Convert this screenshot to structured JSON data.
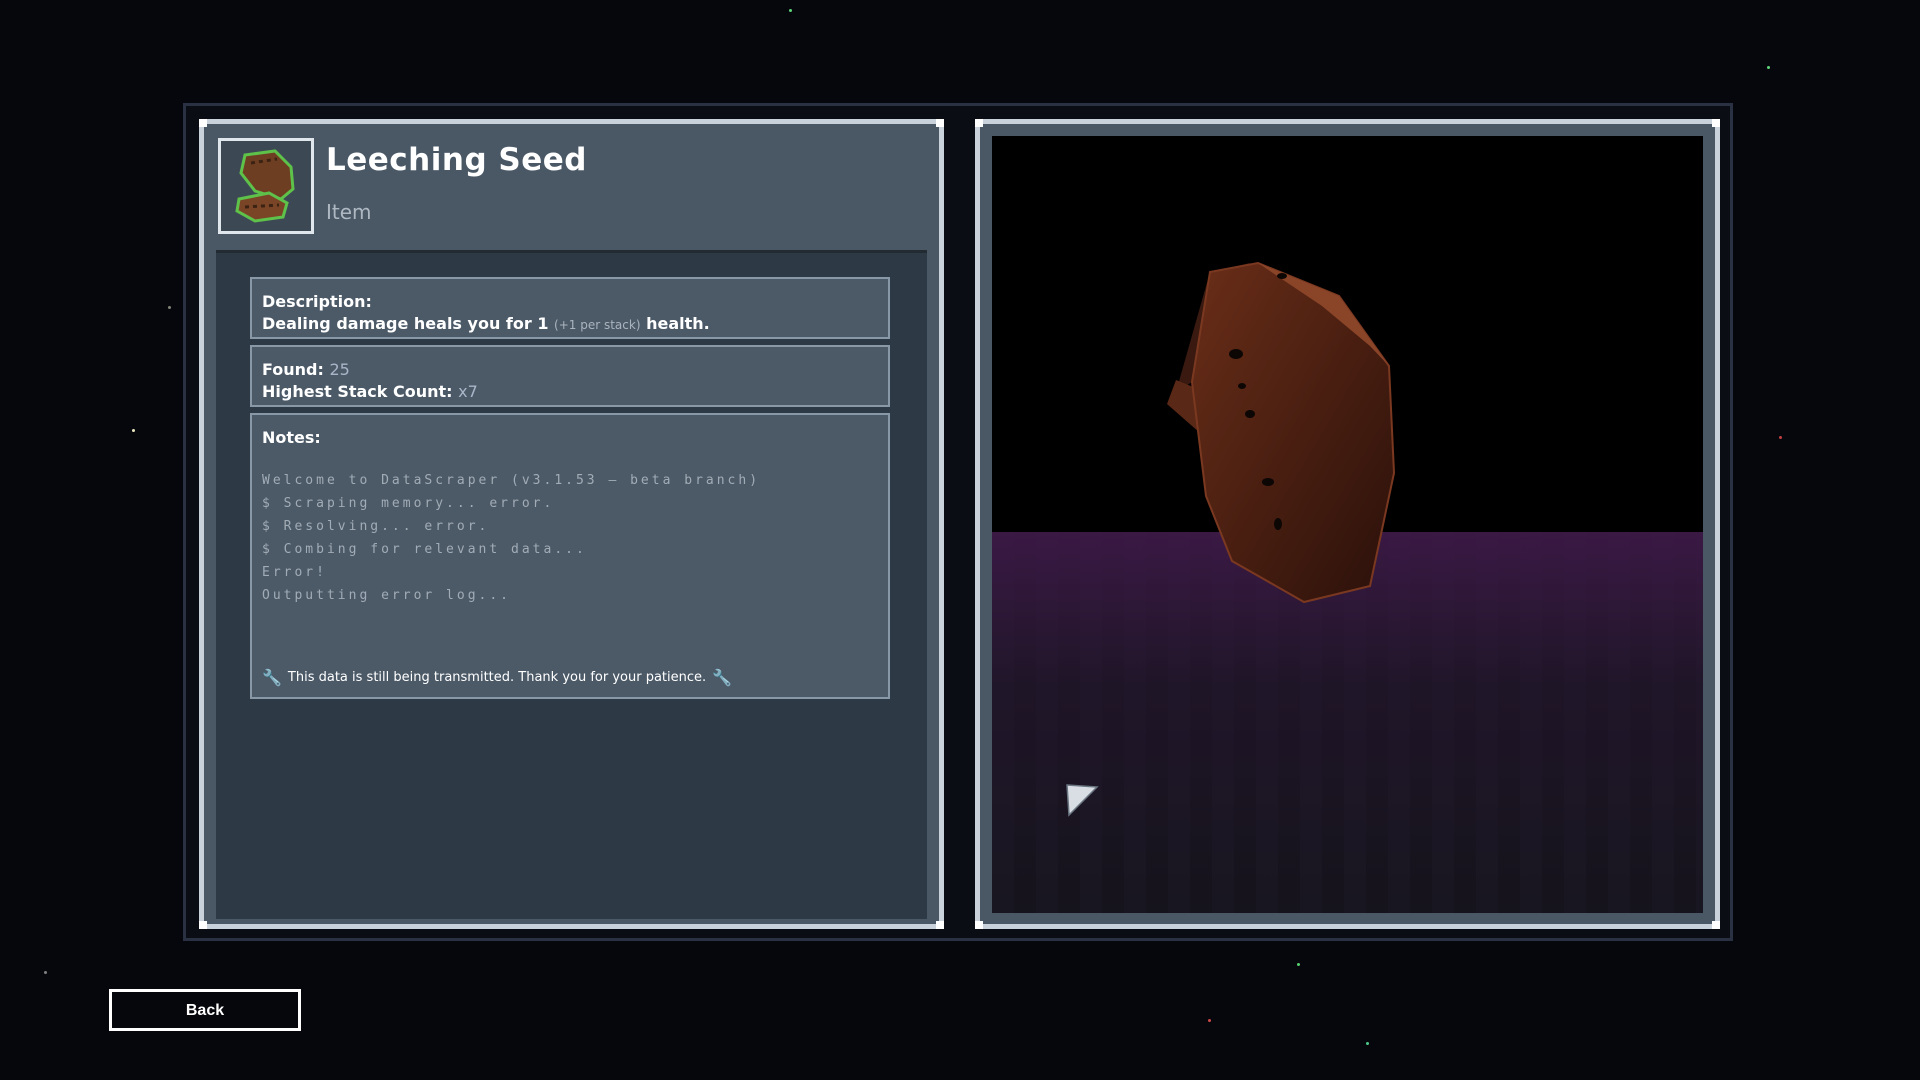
{
  "item": {
    "name": "Leeching Seed",
    "type": "Item",
    "icon": "leeching-seed-icon"
  },
  "description": {
    "label": "Description:",
    "text_before": "Dealing damage heals you for 1 ",
    "stack_note": "(+1 per stack)",
    "text_after": " health."
  },
  "stats": {
    "found_label": "Found:",
    "found_value": "25",
    "stack_label": "Highest Stack Count:",
    "stack_value": "x7"
  },
  "notes": {
    "label": "Notes:",
    "terminal_lines": [
      "Welcome to DataScraper (v3.1.53 – beta branch)",
      "$ Scraping memory... error.",
      "$ Resolving... error.",
      "$ Combing for relevant data...",
      "Error!",
      "Outputting error log..."
    ],
    "footer": "This data is still being transmitted. Thank you for your patience."
  },
  "buttons": {
    "back": "Back"
  },
  "colors": {
    "panel": "#4a5866",
    "accent_wrench": "#f0c23a",
    "item_border": "#5ec24a"
  }
}
